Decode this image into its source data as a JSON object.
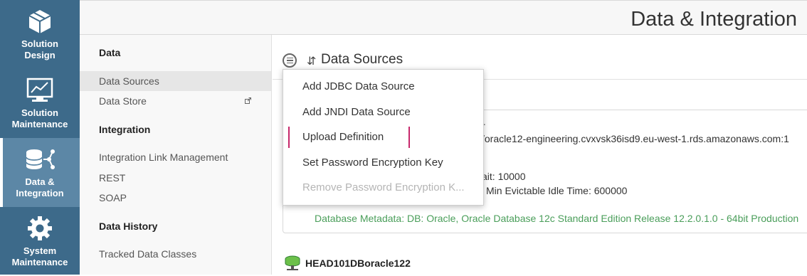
{
  "rail": {
    "items": [
      {
        "label": "Solution\nDesign",
        "icon": "cube-icon"
      },
      {
        "label": "Solution\nMaintenance",
        "icon": "chart-monitor-icon"
      },
      {
        "label": "Data &\nIntegration",
        "icon": "database-network-icon",
        "active": true
      },
      {
        "label": "System\nMaintenance",
        "icon": "gear-icon"
      }
    ]
  },
  "header": {
    "title": "Data & Integration"
  },
  "subnav": {
    "sections": [
      {
        "heading": "Data",
        "items": [
          "Data Sources",
          "Data Store"
        ]
      },
      {
        "heading": "Integration",
        "items": [
          "Integration Link Management",
          "REST",
          "SOAP"
        ]
      },
      {
        "heading": "Data History",
        "items": [
          "Tracked Data Classes"
        ]
      }
    ],
    "active_item": "Data Sources"
  },
  "main": {
    "title": "Data Sources",
    "card": {
      "line1": "r",
      "line2": "/oracle12-engineering.cvxvsk36isd9.eu-west-1.rds.amazonaws.com:1",
      "line3": "ait: 10000",
      "line4": "Min Evictable Idle Time: 600000",
      "metadata": "Database Metadata: DB: Oracle, Oracle Database 12c Standard Edition Release 12.2.0.1.0 - 64bit Production"
    },
    "second_source": "HEAD101DBoracle122"
  },
  "dropdown": {
    "items": [
      {
        "label": "Add JDBC Data Source",
        "disabled": false
      },
      {
        "label": "Add JNDI Data Source",
        "disabled": false
      },
      {
        "label": "Upload Definition",
        "disabled": false,
        "focused": true
      },
      {
        "label": "Set Password Encryption Key",
        "disabled": false
      },
      {
        "label": "Remove Password Encryption K...",
        "disabled": true
      }
    ]
  },
  "colors": {
    "rail_bg": "#3d6a8a",
    "rail_active": "#5c87a6",
    "focus_outline": "#c7286b",
    "metadata_green": "#4a9e5a"
  }
}
